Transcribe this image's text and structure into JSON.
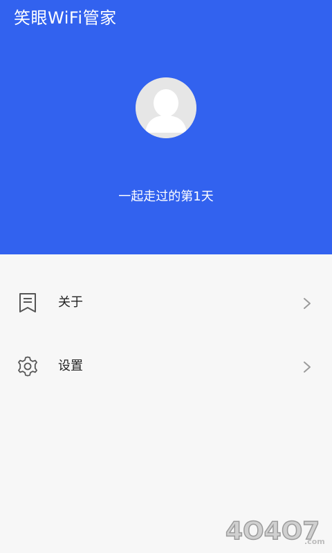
{
  "app": {
    "title": "笑眼WiFi管家"
  },
  "header": {
    "subtitle": "一起走过的第1天",
    "background_color": "#3262ef",
    "avatar_icon": "user-avatar-icon"
  },
  "menu": {
    "items": [
      {
        "label": "关于",
        "icon": "document-icon"
      },
      {
        "label": "设置",
        "icon": "gear-icon"
      }
    ]
  },
  "watermark": {
    "text": "4O4O7",
    "suffix": ".com"
  }
}
